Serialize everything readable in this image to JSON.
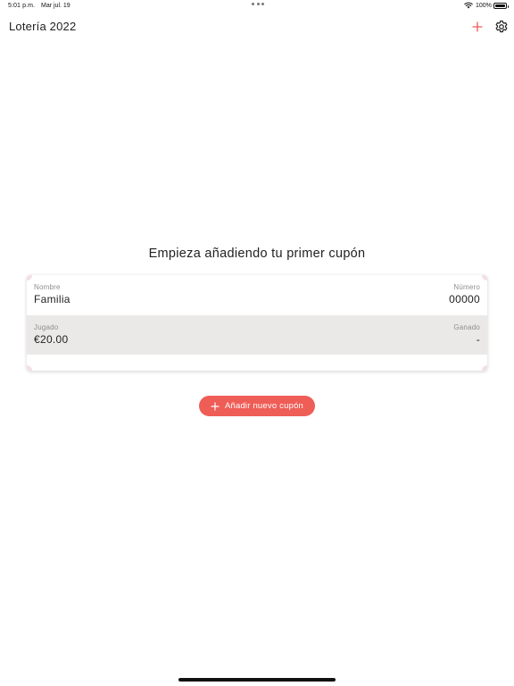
{
  "status_bar": {
    "time": "5:01 p.m.",
    "date": "Mar jul. 19",
    "battery": "100%"
  },
  "nav": {
    "title": "Lotería 2022",
    "icons": {
      "add": "plus-icon",
      "settings": "gear-icon"
    },
    "accent_color": "#ef5d57"
  },
  "empty_state": {
    "heading": "Empieza añadiendo tu primer cupón"
  },
  "coupon": {
    "name_label": "Nombre",
    "name_value": "Familia",
    "number_label": "Número",
    "number_value": "00000",
    "played_label": "Jugado",
    "played_value": "€20.00",
    "won_label": "Ganado",
    "won_value": "-"
  },
  "add_button": {
    "label": "Añadir nuevo cupón",
    "color": "#ef5d57"
  }
}
